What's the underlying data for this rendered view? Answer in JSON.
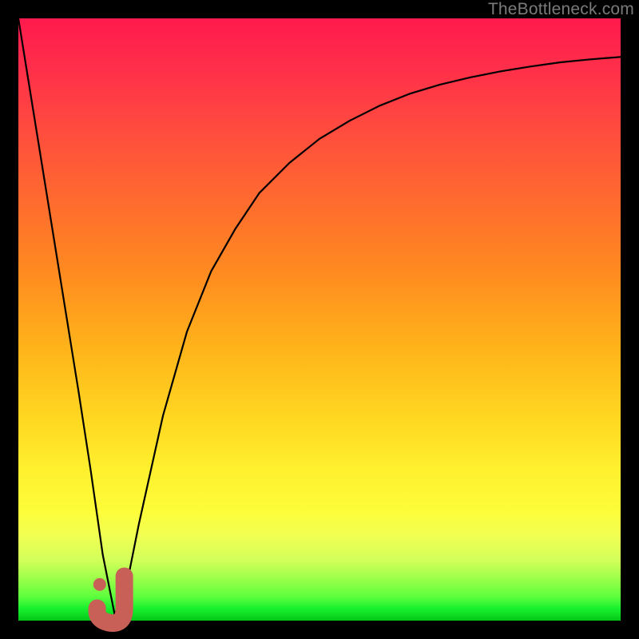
{
  "watermark": {
    "text": "TheBottleneck.com"
  },
  "colors": {
    "background": "#000000",
    "curve": "#000000",
    "marker_stroke": "#c86058",
    "marker_fill": "#c86058"
  },
  "chart_data": {
    "type": "line",
    "title": "",
    "xlabel": "",
    "ylabel": "",
    "xlim": [
      0,
      100
    ],
    "ylim": [
      0,
      100
    ],
    "grid": false,
    "series": [
      {
        "name": "bottleneck-curve",
        "x": [
          0,
          5,
          10,
          12,
          14,
          16,
          18,
          20,
          24,
          28,
          32,
          36,
          40,
          45,
          50,
          55,
          60,
          65,
          70,
          75,
          80,
          85,
          90,
          95,
          100
        ],
        "values": [
          100,
          69,
          38,
          25,
          11,
          1,
          6,
          16,
          34,
          48,
          58,
          65,
          71,
          76,
          80,
          83,
          85.5,
          87.5,
          89,
          90.2,
          91.2,
          92,
          92.7,
          93.2,
          93.6
        ]
      }
    ],
    "marker": {
      "name": "optimal-point-J",
      "x": 16,
      "y": 1,
      "dot": {
        "x": 13.5,
        "y": 6
      }
    },
    "note": "values are bottleneck percentage (0 = no bottleneck / green, 100 = severe bottleneck / red). Inverted so higher value plots higher in the image."
  }
}
